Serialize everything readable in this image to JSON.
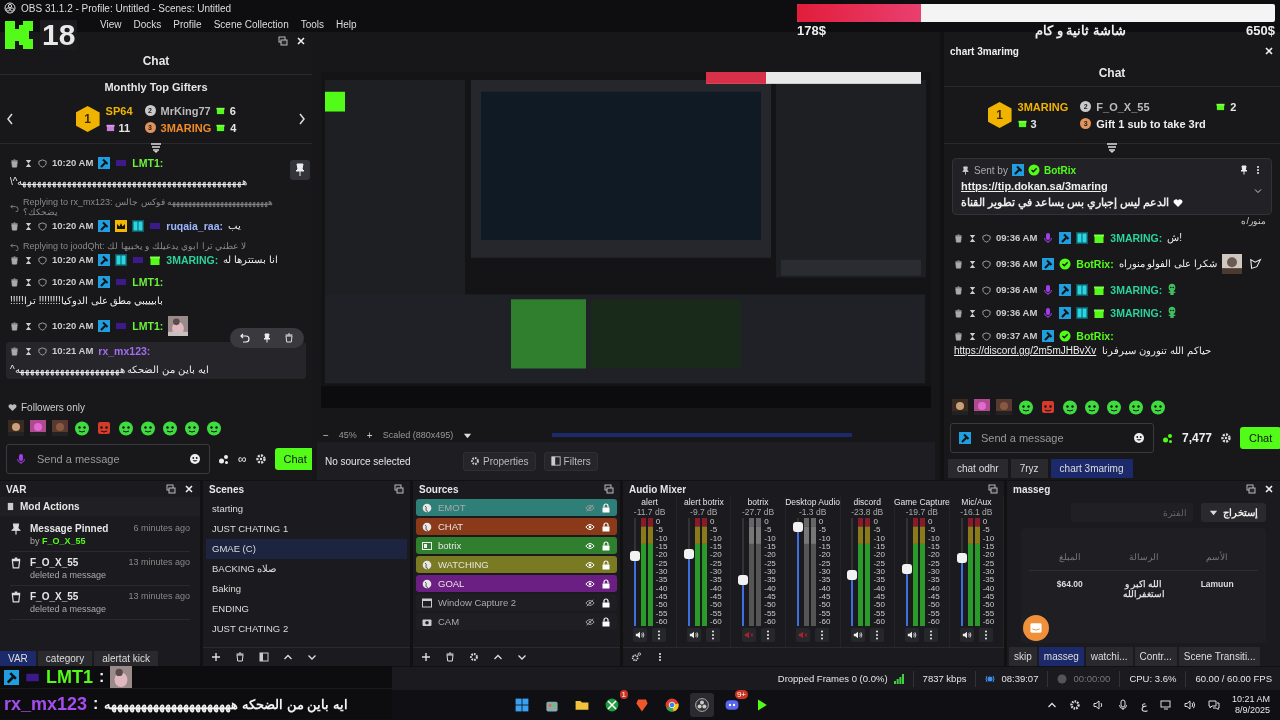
{
  "window": {
    "title": "OBS 31.1.2 - Profile: Untitled - Scenes: Untitled"
  },
  "menu": [
    "View",
    "Docks",
    "Profile",
    "Scene Collection",
    "Tools",
    "Help"
  ],
  "logo_overlay": {
    "text": "18"
  },
  "goal_overlay": {
    "raised": "178$",
    "title": "شاشة ثانية و كام",
    "target": "650$",
    "level": 0.26
  },
  "left_chat": {
    "title": "Chat",
    "gifters_title": "Monthly Top Gifters",
    "gifters": [
      {
        "rank": "1",
        "name": "SP64",
        "count": "11"
      },
      {
        "rank": "2",
        "name": "MrKing77",
        "count": "6"
      },
      {
        "rank": "3",
        "name": "3MARING",
        "count": "4"
      }
    ],
    "messages": [
      {
        "time": "10:20 AM",
        "badges": [
          {
            "kind": "mod"
          },
          {
            "kind": "founder"
          }
        ],
        "user": "LMT1:",
        "color": "#6cf23c",
        "text": "هههههههههههههههههههههههههههههههههههههههههههههه^\\",
        "highlighted": false
      },
      {
        "reply": "Replying to rx_mx123: هههههههههههههههههههههههههه فوكس جالس يضحكك؟",
        "time": "10:20 AM",
        "badges": [
          {
            "kind": "mod"
          },
          {
            "kind": "crown"
          },
          {
            "kind": "og"
          },
          {
            "kind": "founder"
          }
        ],
        "user": "ruqaia_raa:",
        "color": "#9db7ff",
        "text": "يب",
        "highlighted": false
      },
      {
        "reply": "Replying to joodQht: لا عطني ترا ابوي يدعيلك و يخبيها لك",
        "time": "10:20 AM",
        "badges": [
          {
            "kind": "mod"
          },
          {
            "kind": "og"
          },
          {
            "kind": "founder"
          },
          {
            "kind": "gift"
          }
        ],
        "user": "3MARING:",
        "color": "#2bd49a",
        "text": "انا بستترها له",
        "highlighted": false
      },
      {
        "time": "10:20 AM",
        "badges": [
          {
            "kind": "mod"
          },
          {
            "kind": "founder"
          }
        ],
        "user": "LMT1:",
        "color": "#6cf23c",
        "text": "بابيييبي مطق على الدوكيا!!!!!!!! ترا!!!!!",
        "highlighted": false
      },
      {
        "time": "10:20 AM",
        "badges": [
          {
            "kind": "mod"
          },
          {
            "kind": "founder"
          }
        ],
        "user": "LMT1:",
        "color": "#6cf23c",
        "picture": true,
        "highlighted": false
      },
      {
        "time": "10:21 AM",
        "user": "rx_mx123:",
        "color": "#a46cf5",
        "text": "ايه باين من الضحكه هههههههههههههههههههههه^",
        "highlighted": true
      }
    ],
    "followers_only": "Followers only",
    "input": {
      "placeholder": "Send a message"
    },
    "points": "∞",
    "send": "Chat"
  },
  "right_chat": {
    "dock_title": "chart 3marimg",
    "title": "Chat",
    "gifters": [
      {
        "rank": "1",
        "name": "3MARING",
        "count": "3"
      },
      {
        "rank": "2",
        "name": "F_O_X_55",
        "count": "2"
      },
      {
        "rank": "3",
        "name": "Gift 1 sub to take 3rd"
      }
    ],
    "pinned": {
      "label": "Sent by",
      "user": "BotRix",
      "link": "https://tip.dokan.sa/3maring",
      "text": "الدعم ليس إجباري بس يساعد في تطوير القناة"
    },
    "fragment": "منور/ه",
    "messages": [
      {
        "time": "09:36 AM",
        "badges": [
          {
            "kind": "mic"
          },
          {
            "kind": "mod"
          },
          {
            "kind": "og"
          },
          {
            "kind": "gift"
          }
        ],
        "user": "3MARING:",
        "color": "#2bd49a",
        "text": "!ش"
      },
      {
        "time": "09:36 AM",
        "badges": [
          {
            "kind": "mod"
          },
          {
            "kind": "verified"
          }
        ],
        "user": "BotRix:",
        "color": "#53fc18",
        "text": "شكرا على الفولو منوراه",
        "picture": true
      },
      {
        "time": "09:36 AM",
        "badges": [
          {
            "kind": "mic"
          },
          {
            "kind": "mod"
          },
          {
            "kind": "og"
          },
          {
            "kind": "gift"
          }
        ],
        "user": "3MARING:",
        "color": "#2bd49a",
        "emote": true
      },
      {
        "time": "09:36 AM",
        "badges": [
          {
            "kind": "mic"
          },
          {
            "kind": "mod"
          },
          {
            "kind": "og"
          },
          {
            "kind": "gift"
          }
        ],
        "user": "3MARING:",
        "color": "#2bd49a",
        "emote": true
      },
      {
        "time": "09:37 AM",
        "badges": [
          {
            "kind": "mod"
          },
          {
            "kind": "verified"
          }
        ],
        "user": "BotRix:",
        "color": "#53fc18",
        "link": "https://discord.gg/2m5mJHBvXv",
        "text": "حياكم الله تنورون سيرفرنا"
      }
    ],
    "input": {
      "placeholder": "Send a message"
    },
    "points": "7,477",
    "send": "Chat",
    "tabs": [
      {
        "label": "chat odhr",
        "selected": false
      },
      {
        "label": "7ryz",
        "selected": false
      },
      {
        "label": "chart 3marimg",
        "selected": true
      }
    ]
  },
  "preview": {
    "zoom": "45%",
    "zoom_out": "−",
    "zoom_in": "+",
    "scale": "Scaled (880x495)"
  },
  "context_bar": {
    "status": "No source selected",
    "buttons": [
      "Properties",
      "Filters"
    ]
  },
  "var_dock": {
    "title": "VAR",
    "section": "Mod Actions",
    "actions": [
      {
        "kind": "pin",
        "title": "Message Pinned",
        "by_label": "by",
        "by": "F_O_X_55",
        "time": "6 minutes ago"
      },
      {
        "kind": "delete",
        "title": "F_O_X_55",
        "detail": "deleted a message",
        "time": "13 minutes ago"
      },
      {
        "kind": "delete",
        "title": "F_O_X_55",
        "detail": "deleted a message",
        "time": "13 minutes ago"
      }
    ],
    "tabs": [
      {
        "label": "VAR",
        "selected": true
      },
      {
        "label": "category",
        "selected": false
      },
      {
        "label": "alertat kick",
        "selected": false
      }
    ]
  },
  "scenes": {
    "title": "Scenes",
    "items": [
      {
        "name": "starting",
        "selected": false
      },
      {
        "name": "JUST CHATING 1",
        "selected": false
      },
      {
        "name": "GMAE (C)",
        "selected": true
      },
      {
        "name": "BACKING صلاه",
        "selected": false
      },
      {
        "name": "Baking",
        "selected": false
      },
      {
        "name": "ENDING",
        "selected": false
      },
      {
        "name": "JUST CHATING 2",
        "selected": false
      }
    ]
  },
  "sources": {
    "title": "Sources",
    "items": [
      {
        "kind": "browser",
        "name": "EMOT",
        "color": "#2e7f78",
        "visible": false,
        "locked": true
      },
      {
        "kind": "browser",
        "name": "CHAT",
        "color": "#8a3a18",
        "visible": true,
        "locked": true
      },
      {
        "kind": "media",
        "name": "botrix",
        "color": "#2f7f2f",
        "visible": true,
        "locked": true
      },
      {
        "kind": "browser",
        "name": "WATCHING",
        "color": "#7a7a22",
        "visible": true,
        "locked": true
      },
      {
        "kind": "browser",
        "name": "GOAL",
        "color": "#6c1f82",
        "visible": true,
        "locked": true
      },
      {
        "kind": "window",
        "name": "Window Capture 2",
        "visible": false,
        "locked": true
      },
      {
        "kind": "camera",
        "name": "CAM",
        "visible": false,
        "locked": true
      }
    ]
  },
  "mixer": {
    "title": "Audio Mixer",
    "channels": [
      {
        "name": "alert",
        "reading": "-11.7 dB",
        "level": 0.65,
        "muted": false,
        "scale": [
          "0",
          "-5",
          "-10",
          "-15",
          "-20",
          "-25",
          "-30",
          "-35",
          "-40",
          "-45",
          "-50",
          "-55",
          "-60"
        ]
      },
      {
        "name": "alert botrix",
        "reading": "-9.7 dB",
        "level": 0.67,
        "muted": false,
        "scale": [
          "0",
          "-5",
          "-10",
          "-15",
          "-20",
          "-25",
          "-30",
          "-35",
          "-40",
          "-45",
          "-50",
          "-55",
          "-60"
        ]
      },
      {
        "name": "botrix",
        "reading": "-27.7 dB",
        "level": 0.43,
        "muted": true,
        "scale": [
          "0",
          "-5",
          "-10",
          "-15",
          "-20",
          "-25",
          "-30",
          "-35",
          "-40",
          "-45",
          "-50",
          "-55",
          "-60"
        ]
      },
      {
        "name": "Desktop Audio",
        "reading": "-1.3 dB",
        "level": 0.92,
        "muted": true,
        "scale": [
          "0",
          "-5",
          "-10",
          "-15",
          "-20",
          "-25",
          "-30",
          "-35",
          "-40",
          "-45",
          "-50",
          "-55",
          "-60"
        ]
      },
      {
        "name": "discord",
        "reading": "-23.8 dB",
        "level": 0.47,
        "muted": false,
        "scale": [
          "0",
          "-5",
          "-10",
          "-15",
          "-20",
          "-25",
          "-30",
          "-35",
          "-40",
          "-45",
          "-50",
          "-55",
          "-60"
        ]
      },
      {
        "name": "Game Capture",
        "reading": "-19.7 dB",
        "level": 0.53,
        "muted": false,
        "scale": [
          "0",
          "-5",
          "-10",
          "-15",
          "-20",
          "-25",
          "-30",
          "-35",
          "-40",
          "-45",
          "-50",
          "-55",
          "-60"
        ]
      },
      {
        "name": "Mic/Aux",
        "reading": "-16.1 dB",
        "level": 0.63,
        "muted": false,
        "scale": [
          "0",
          "-5",
          "-10",
          "-15",
          "-20",
          "-25",
          "-30",
          "-35",
          "-40",
          "-45",
          "-50",
          "-55",
          "-60"
        ]
      }
    ]
  },
  "masseg": {
    "title": "masseg",
    "export": "إستخراج",
    "period": {
      "placeholder": "الفترة"
    },
    "columns": [
      "المبلغ",
      "الرسالة",
      "الأسم"
    ],
    "rows": [
      [
        "$64.00",
        "الله اكبر و استغفرالله",
        "Lamuun"
      ]
    ],
    "tabs": [
      {
        "label": "skip",
        "selected": false
      },
      {
        "label": "masseg",
        "selected": true
      },
      {
        "label": "watchi...",
        "selected": false
      },
      {
        "label": "Contr...",
        "selected": false
      },
      {
        "label": "Scene Transiti...",
        "selected": false
      }
    ]
  },
  "status_bar": {
    "dropped": "Dropped Frames 0 (0.0%)",
    "bitrate": "7837 kbps",
    "stream_time": "08:39:07",
    "record_time": "00:00:00",
    "cpu": "CPU: 3.6%",
    "fps": "60.00 / 60.00 FPS"
  },
  "chat_overlay": [
    {
      "user": "LMT1",
      "separator": ":",
      "picture": true
    },
    {
      "user": "rx_mx123",
      "separator": ":",
      "text": "ايه باين من الضحكه هههههههههههههههههههههه"
    }
  ],
  "taskbar": {
    "apps": [
      {
        "kind": "windows",
        "selected": false
      },
      {
        "kind": "store",
        "selected": false
      },
      {
        "kind": "folder",
        "selected": false
      },
      {
        "kind": "xbox",
        "badge": "1",
        "selected": false
      },
      {
        "kind": "brave",
        "selected": false
      },
      {
        "kind": "chrome",
        "selected": false
      },
      {
        "kind": "obs",
        "selected": true
      },
      {
        "kind": "discord",
        "badge": "9+",
        "selected": false
      },
      {
        "kind": "kick",
        "selected": false
      }
    ],
    "language": "ع",
    "time": "10:21 AM",
    "date": "8/9/2025"
  }
}
